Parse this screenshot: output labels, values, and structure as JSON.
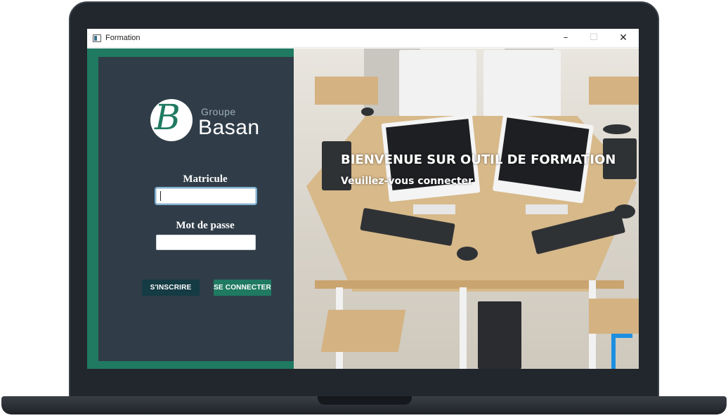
{
  "window": {
    "title": "Formation",
    "minimize_glyph": "–",
    "maximize_glyph": "☐",
    "close_glyph": "✕"
  },
  "logo": {
    "letter": "B",
    "groupe": "Groupe",
    "name": "Basan"
  },
  "login": {
    "matricule_label": "Matricule",
    "matricule_value": "",
    "password_label": "Mot de passe",
    "password_value": "",
    "register_button": "S'INSCRIRE",
    "login_button": "SE CONNECTER"
  },
  "hero": {
    "title": "BIENVENUE SUR OUTIL DE FORMATION",
    "subtitle": "Veuillez-vous connecter"
  },
  "colors": {
    "accent_green": "#1f7a61",
    "panel_dark": "#303d48",
    "register_dark": "#153b44"
  },
  "icons": {
    "app": "app-window-icon",
    "minimize": "minimize-icon",
    "maximize": "maximize-icon",
    "close": "close-icon"
  }
}
